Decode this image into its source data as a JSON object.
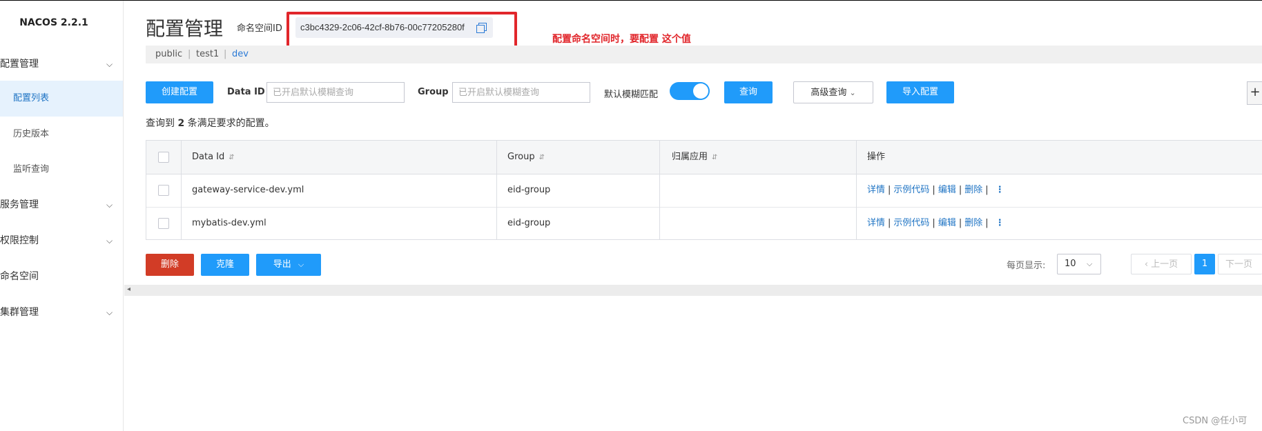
{
  "app": {
    "brand": "NACOS 2.2.1"
  },
  "sidebar": {
    "items": [
      {
        "label": "配置管理",
        "has_chevron": true
      },
      {
        "label": "配置列表",
        "sub": true,
        "active": true
      },
      {
        "label": "历史版本",
        "sub": true
      },
      {
        "label": "监听查询",
        "sub": true
      },
      {
        "label": "服务管理",
        "has_chevron": true
      },
      {
        "label": "权限控制",
        "has_chevron": true
      },
      {
        "label": "命名空间"
      },
      {
        "label": "集群管理",
        "has_chevron": true
      }
    ],
    "chevron": "⌵"
  },
  "header": {
    "title": "配置管理",
    "namespace_label": "命名空间ID",
    "namespace_id": "c3bc4329-2c06-42cf-8b76-00c77205280f",
    "annotation": "配置命名空间时，要配置 这个值",
    "namespaces": [
      "public",
      "test1",
      "dev"
    ],
    "separator": "|",
    "active_namespace": "dev"
  },
  "toolbar": {
    "create_label": "创建配置",
    "dataid_label": "Data ID",
    "dataid_placeholder": "已开启默认模糊查询",
    "group_label": "Group",
    "group_placeholder": "已开启默认模糊查询",
    "fuzzy_label": "默认模糊匹配",
    "fuzzy_on": true,
    "query_label": "查询",
    "advanced_label": "高级查询",
    "advanced_chevron": "⌄",
    "import_label": "导入配置",
    "plus": "+"
  },
  "summary": {
    "prefix": "查询到",
    "count": "2",
    "suffix": "条满足要求的配置。"
  },
  "table": {
    "columns": [
      "Data Id",
      "Group",
      "归属应用",
      "操作"
    ],
    "sort_icon": "⇵",
    "rows": [
      {
        "data_id": "gateway-service-dev.yml",
        "group": "eid-group",
        "app": ""
      },
      {
        "data_id": "mybatis-dev.yml",
        "group": "eid-group",
        "app": ""
      }
    ],
    "ops": [
      "详情",
      "示例代码",
      "编辑",
      "删除"
    ],
    "op_sep": "|",
    "more": "⋮"
  },
  "footer": {
    "delete_label": "删除",
    "clone_label": "克隆",
    "export_label": "导出",
    "export_chevron": "⌵",
    "page_size_label": "每页显示:",
    "page_size": "10",
    "page_size_chevron": "⌵",
    "prev_label": "上一页",
    "current_page": "1",
    "next_label": "下一页",
    "prev_icon": "‹",
    "scroll_left": "◂"
  },
  "watermark": "CSDN @任小可",
  "colors": {
    "primary": "#209bfa",
    "danger": "#d23c26",
    "annotation": "#e1262b"
  }
}
